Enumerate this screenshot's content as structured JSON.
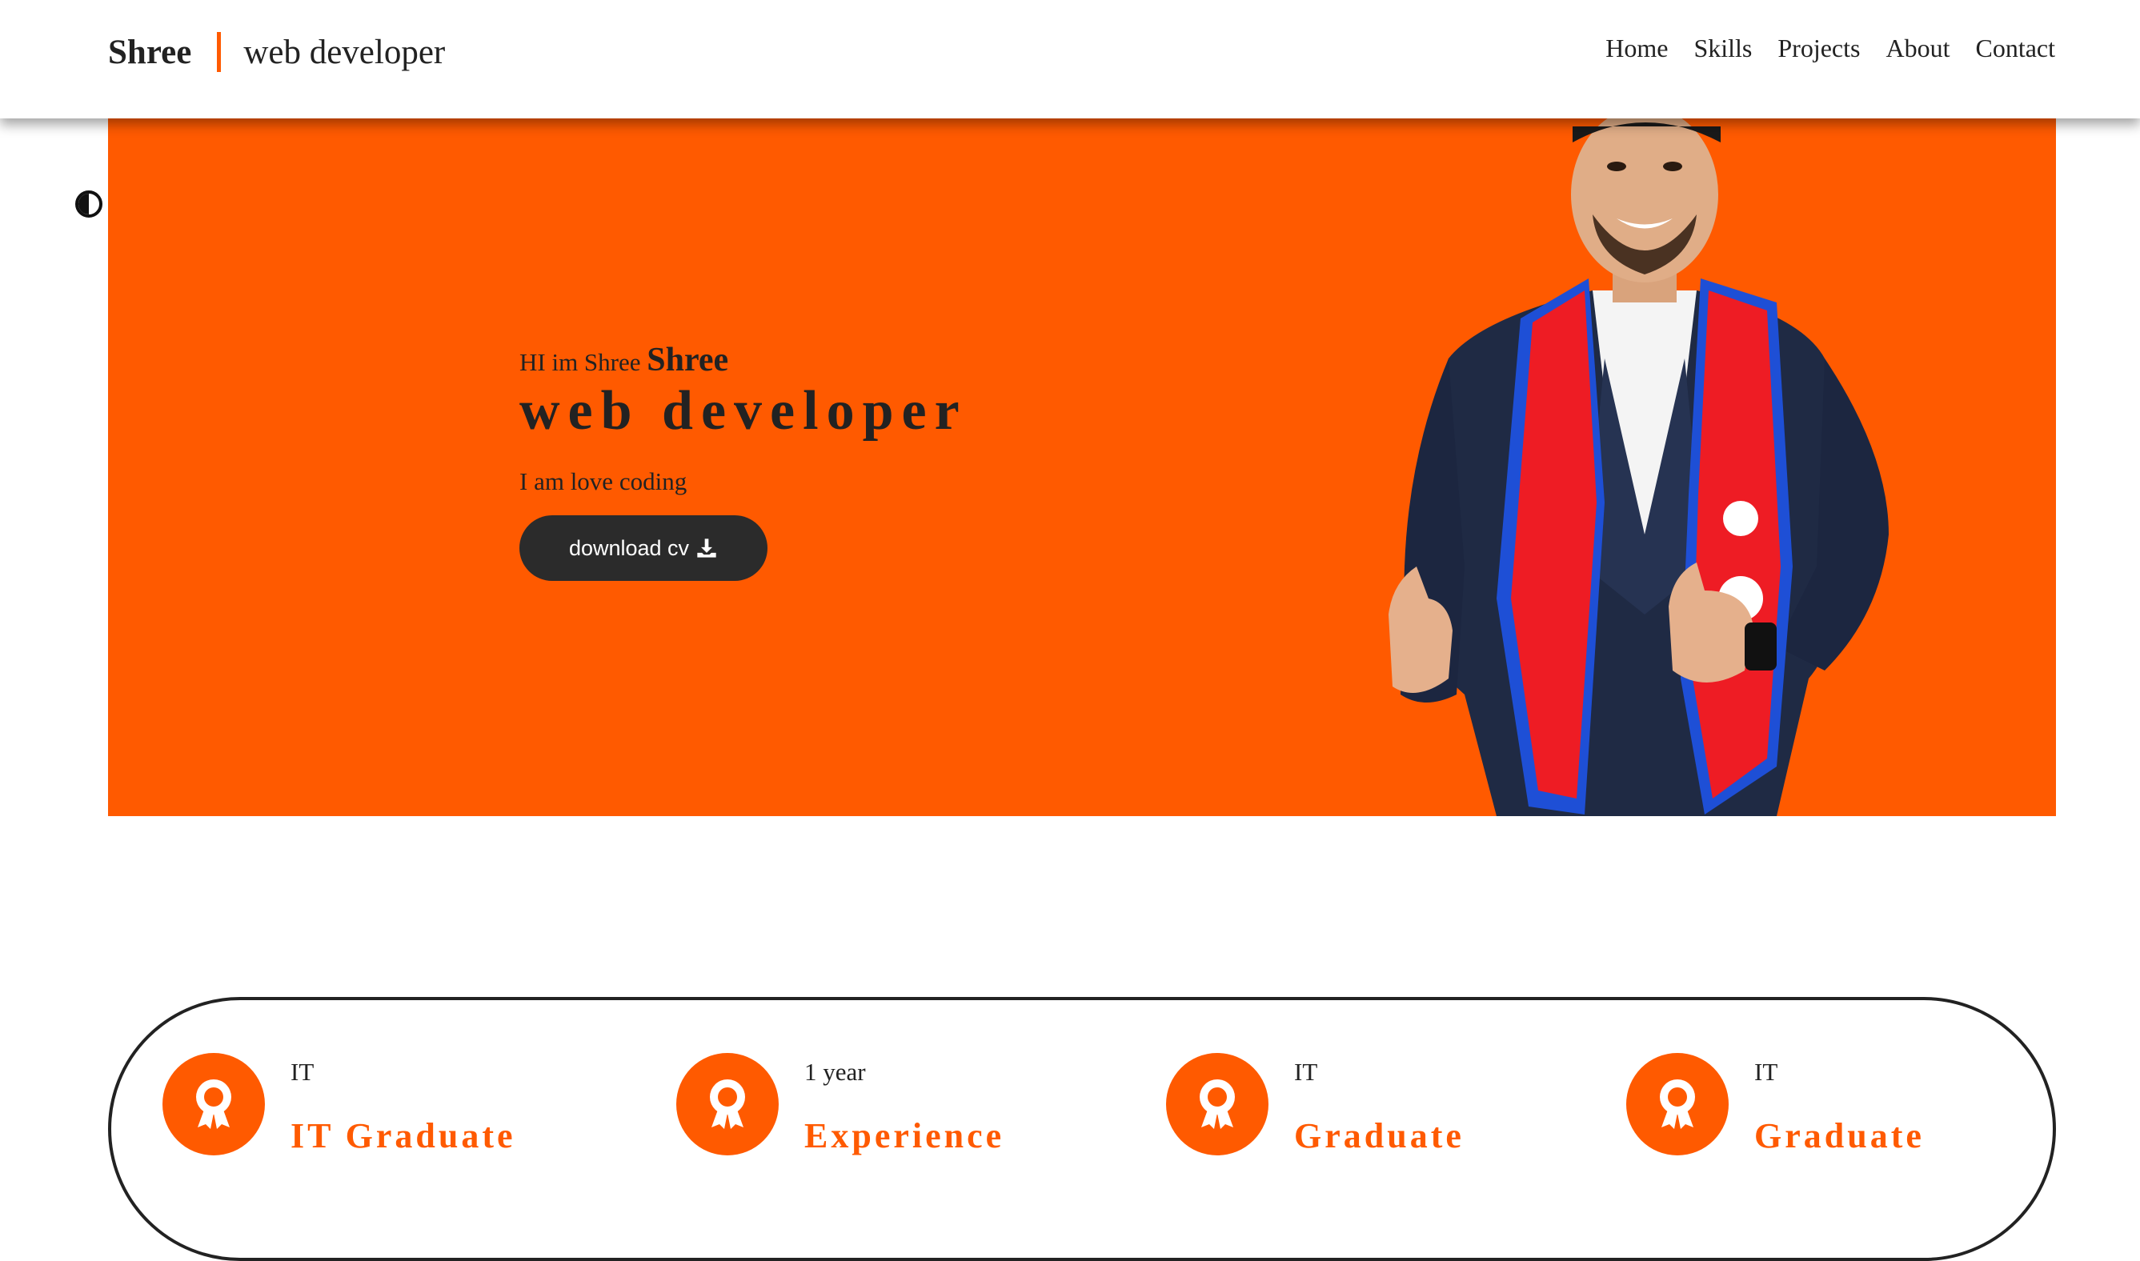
{
  "header": {
    "brand_name": "Shree",
    "brand_role": "web developer",
    "nav": [
      "Home",
      "Skills",
      "Projects",
      "About",
      "Contact"
    ]
  },
  "theme_toggle": {
    "icon": "contrast-icon"
  },
  "hero": {
    "greeting": "HI im Shree",
    "name": "Shree",
    "title": "web developer",
    "tagline": "I am love coding",
    "cv_button_label": "download cv",
    "cv_button_icon": "download-icon",
    "background_color": "#ff5a00"
  },
  "stats": [
    {
      "icon": "award-icon",
      "top": "IT",
      "main": "IT Graduate"
    },
    {
      "icon": "award-icon",
      "top": "1 year",
      "main": "Experience"
    },
    {
      "icon": "award-icon",
      "top": "IT",
      "main": "Graduate"
    },
    {
      "icon": "award-icon",
      "top": "IT",
      "main": "Graduate"
    }
  ],
  "colors": {
    "accent": "#ff5a00",
    "dark": "#2b2b2b"
  }
}
